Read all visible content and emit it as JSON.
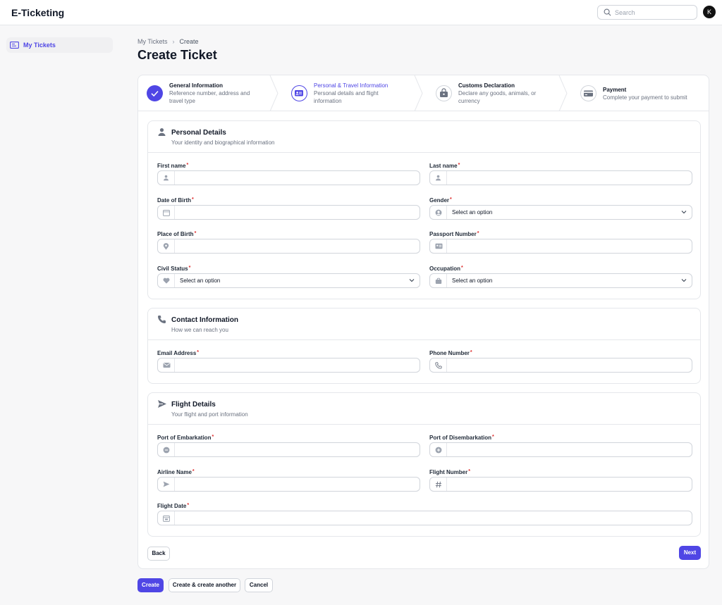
{
  "app": {
    "title": "E-Ticketing",
    "avatar_initial": "K"
  },
  "search": {
    "placeholder": "Search"
  },
  "sidebar": {
    "items": [
      {
        "label": "My Tickets",
        "icon": "ticket-icon"
      }
    ]
  },
  "breadcrumbs": [
    "My Tickets",
    "Create"
  ],
  "page_title": "Create Ticket",
  "steps": [
    {
      "title": "General Information",
      "description": "Reference number, address and travel type",
      "state": "complete",
      "icon": "check-icon"
    },
    {
      "title": "Personal & Travel Information",
      "description": "Personal details and flight information",
      "state": "current",
      "icon": "id-card-icon"
    },
    {
      "title": "Customs Declaration",
      "description": "Declare any goods, animals, or currency",
      "state": "upcoming",
      "icon": "bag-icon"
    },
    {
      "title": "Payment",
      "description": "Complete your payment to submit",
      "state": "upcoming",
      "icon": "credit-card-icon"
    }
  ],
  "sections": {
    "personal": {
      "title": "Personal Details",
      "subtitle": "Your identity and biographical information",
      "fields": {
        "first_name": {
          "label": "First name",
          "required": "*"
        },
        "last_name": {
          "label": "Last name",
          "required": "*"
        },
        "dob": {
          "label": "Date of Birth",
          "required": "*"
        },
        "gender": {
          "label": "Gender",
          "required": "*",
          "value": "Select an option"
        },
        "pob": {
          "label": "Place of Birth",
          "required": "*"
        },
        "passport": {
          "label": "Passport Number",
          "required": "*"
        },
        "civil_status": {
          "label": "Civil Status",
          "required": "*",
          "value": "Select an option"
        },
        "occupation": {
          "label": "Occupation",
          "required": "*",
          "value": "Select an option"
        }
      }
    },
    "contact": {
      "title": "Contact Information",
      "subtitle": "How we can reach you",
      "fields": {
        "email": {
          "label": "Email Address",
          "required": "*"
        },
        "phone": {
          "label": "Phone Number",
          "required": "*"
        }
      }
    },
    "flight": {
      "title": "Flight Details",
      "subtitle": "Your flight and port information",
      "fields": {
        "embark": {
          "label": "Port of Embarkation",
          "required": "*"
        },
        "disembark": {
          "label": "Port of Disembarkation",
          "required": "*"
        },
        "airline": {
          "label": "Airline Name",
          "required": "*"
        },
        "flight_no": {
          "label": "Flight Number",
          "required": "*"
        },
        "flight_date": {
          "label": "Flight Date",
          "required": "*"
        }
      }
    }
  },
  "wizard_actions": {
    "back": "Back",
    "next": "Next"
  },
  "form_actions": {
    "create": "Create",
    "create_another": "Create & create another",
    "cancel": "Cancel"
  },
  "colors": {
    "accent": "#4f46e5",
    "required": "#dc2626"
  }
}
